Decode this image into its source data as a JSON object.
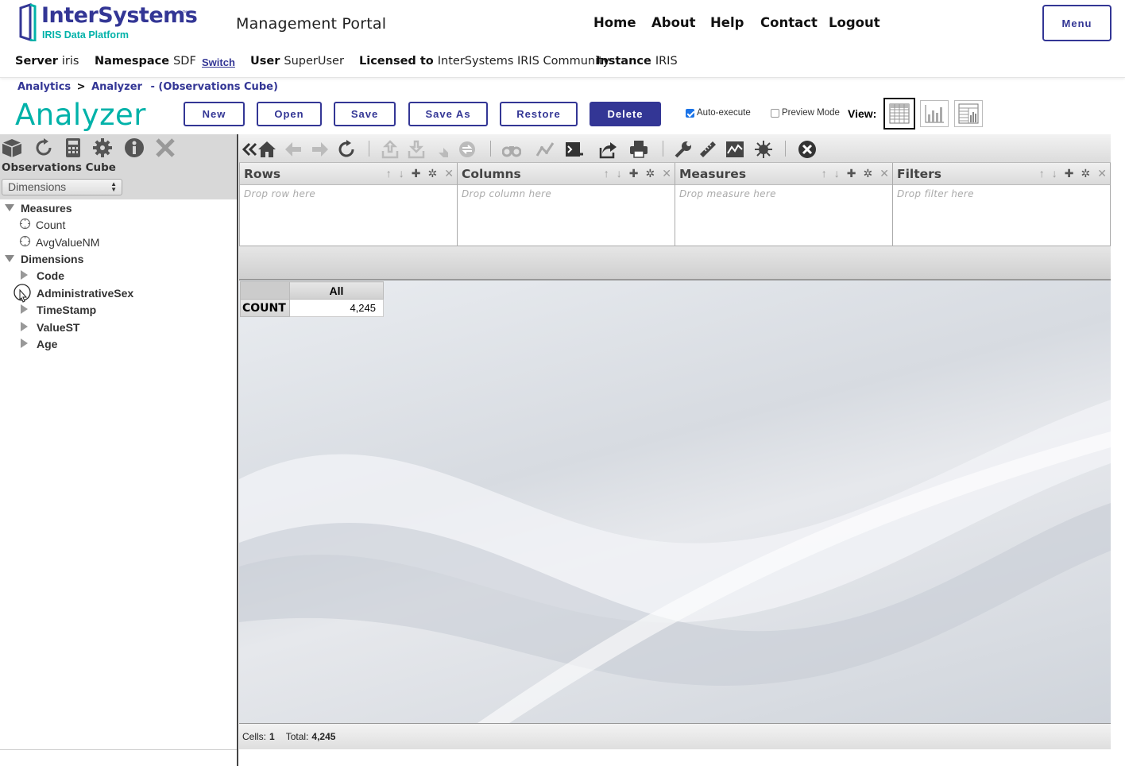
{
  "header": {
    "logo_name": "InterSystems",
    "logo_tm": "™",
    "logo_sub": "IRIS Data Platform",
    "portal_title": "Management Portal",
    "nav": [
      "Home",
      "About",
      "Help",
      "Contact",
      "Logout"
    ],
    "menu_label": "Menu"
  },
  "info": {
    "server_label": "Server",
    "server": "iris",
    "namespace_label": "Namespace",
    "namespace": "SDF",
    "switch_label": "Switch",
    "user_label": "User",
    "user": "SuperUser",
    "licensed_label": "Licensed to",
    "licensed": "InterSystems IRIS Community",
    "instance_label": "Instance",
    "instance": "IRIS"
  },
  "breadcrumb": {
    "items": [
      "Analytics",
      "Analyzer"
    ],
    "separator": ">",
    "suffix": "- (Observations Cube)"
  },
  "page_title": "Analyzer",
  "buttons": {
    "new": "New",
    "open": "Open",
    "save": "Save",
    "save_as": "Save As",
    "restore": "Restore",
    "delete": "Delete"
  },
  "options": {
    "auto_execute": "Auto-execute",
    "auto_execute_checked": true,
    "preview_mode": "Preview Mode",
    "preview_mode_checked": false,
    "view_label": "View:"
  },
  "left_panel": {
    "cube_name": "Observations Cube",
    "selector": "Dimensions",
    "tree": {
      "measures_label": "Measures",
      "measures": [
        "Count",
        "AvgValueNM"
      ],
      "dimensions_label": "Dimensions",
      "dimensions": [
        "Code",
        "AdministrativeSex",
        "TimeStamp",
        "ValueST",
        "Age"
      ]
    }
  },
  "boxes": {
    "rows": {
      "title": "Rows",
      "placeholder": "Drop row here"
    },
    "columns": {
      "title": "Columns",
      "placeholder": "Drop column here"
    },
    "measures": {
      "title": "Measures",
      "placeholder": "Drop measure here"
    },
    "filters": {
      "title": "Filters",
      "placeholder": "Drop filter here"
    }
  },
  "pivot": {
    "column_header": "All",
    "row_header": "COUNT",
    "value": "4,245"
  },
  "status": {
    "cells_label": "Cells:",
    "cells": "1",
    "total_label": "Total:",
    "total": "4,245"
  },
  "colors": {
    "brand": "#333695",
    "accent": "#00b2a9"
  }
}
